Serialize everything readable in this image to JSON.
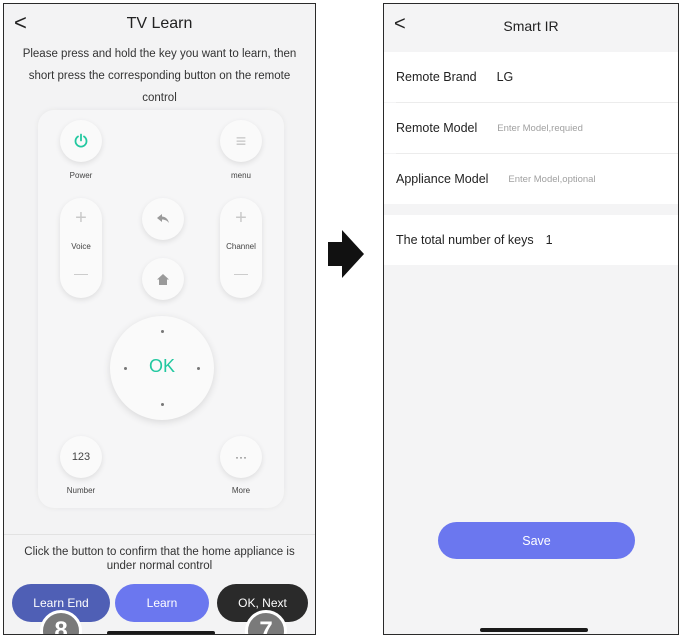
{
  "left_screen": {
    "title": "TV Learn",
    "back_glyph": "<",
    "instruction": "Please press and hold the key you want to learn, then short press the corresponding button on the remote control",
    "remote": {
      "power_label": "Power",
      "menu_label": "menu",
      "voice_label": "Voice",
      "channel_label": "Channel",
      "ok_label": "OK",
      "number_button": "123",
      "number_label": "Number",
      "more_button": "···",
      "more_label": "More",
      "plus_glyph": "+",
      "minus_glyph": "—",
      "menu_glyph": "≡",
      "accent_color": "#22c8a0"
    },
    "confirm_text": "Click the button to confirm that the home appliance is under normal control",
    "buttons": {
      "learn_end": "Learn End",
      "learn": "Learn",
      "ok_next": "OK, Next"
    },
    "badges": {
      "left": "8",
      "right": "7"
    }
  },
  "right_screen": {
    "title": "Smart IR",
    "back_glyph": "<",
    "remote_brand": {
      "label": "Remote Brand",
      "value": "LG"
    },
    "remote_model": {
      "label": "Remote Model",
      "placeholder": "Enter Model,requied"
    },
    "appliance_model": {
      "label": "Appliance Model",
      "placeholder": "Enter Model,optional"
    },
    "total_keys": {
      "label": "The total number of keys",
      "value": "1"
    },
    "save_label": "Save",
    "accent_color": "#6b77ef"
  },
  "arrow_icon": "right-arrow-icon"
}
